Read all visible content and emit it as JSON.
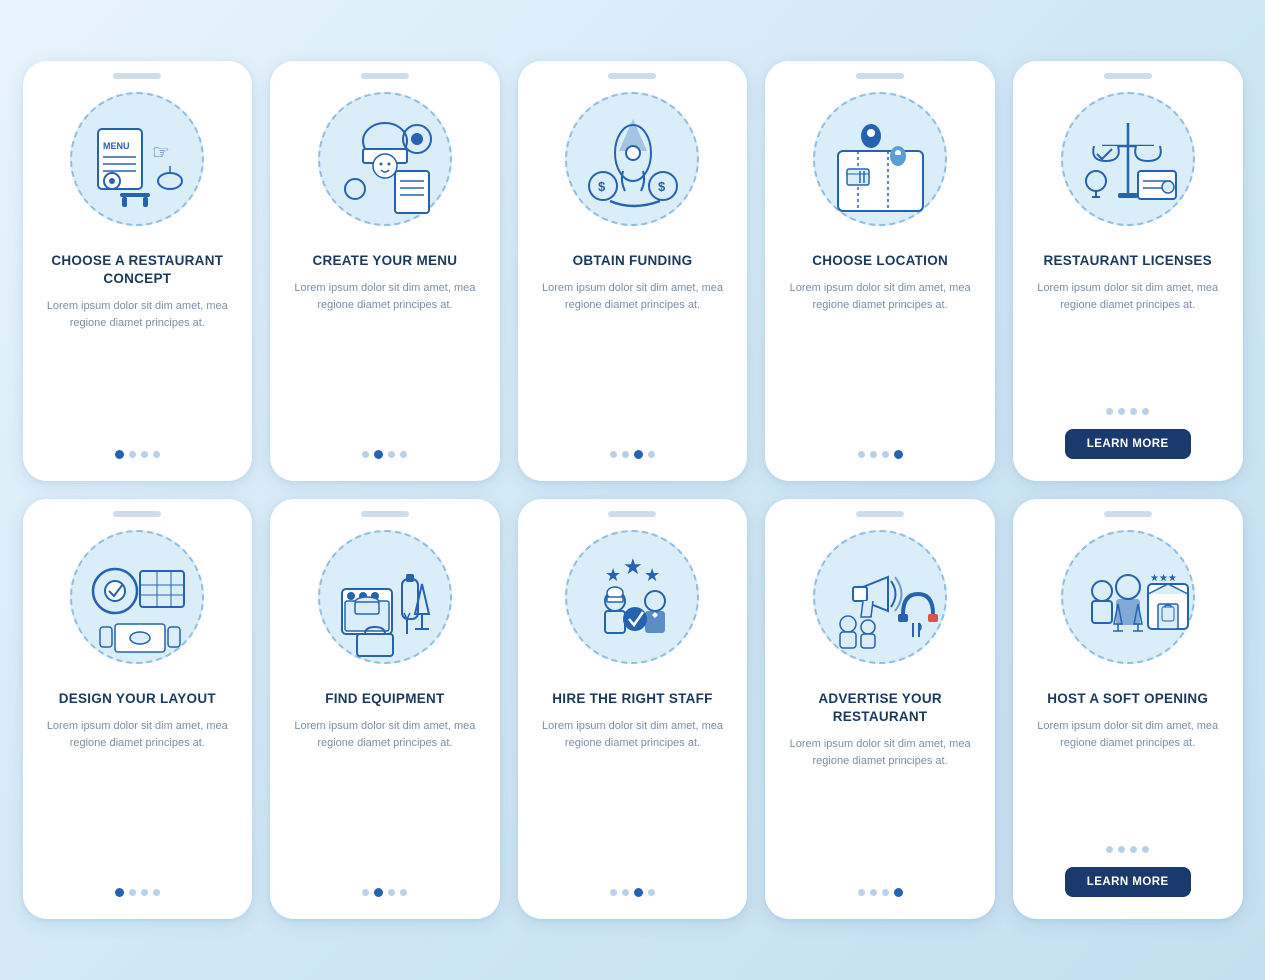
{
  "cards": [
    {
      "id": "choose-concept",
      "title": "CHOOSE A RESTAURANT CONCEPT",
      "body": "Lorem ipsum dolor sit dim amet, mea regione diamet principes at.",
      "dots": [
        1,
        0,
        0,
        0
      ],
      "hasButton": false,
      "buttonLabel": ""
    },
    {
      "id": "create-menu",
      "title": "CREATE YOUR MENU",
      "body": "Lorem ipsum dolor sit dim amet, mea regione diamet principes at.",
      "dots": [
        0,
        1,
        0,
        0
      ],
      "hasButton": false,
      "buttonLabel": ""
    },
    {
      "id": "obtain-funding",
      "title": "OBTAIN FUNDING",
      "body": "Lorem ipsum dolor sit dim amet, mea regione diamet principes at.",
      "dots": [
        0,
        0,
        1,
        0
      ],
      "hasButton": false,
      "buttonLabel": ""
    },
    {
      "id": "choose-location",
      "title": "CHOOSE LOCATION",
      "body": "Lorem ipsum dolor sit dim amet, mea regione diamet principes at.",
      "dots": [
        0,
        0,
        0,
        1
      ],
      "hasButton": false,
      "buttonLabel": ""
    },
    {
      "id": "restaurant-licenses",
      "title": "RESTAURANT LICENSES",
      "body": "Lorem ipsum dolor sit dim amet, mea regione diamet principes at.",
      "dots": [
        0,
        0,
        0,
        0
      ],
      "hasButton": true,
      "buttonLabel": "LEARN MORE"
    },
    {
      "id": "design-layout",
      "title": "DESIGN YOUR LAYOUT",
      "body": "Lorem ipsum dolor sit dim amet, mea regione diamet principes at.",
      "dots": [
        1,
        0,
        0,
        0
      ],
      "hasButton": false,
      "buttonLabel": ""
    },
    {
      "id": "find-equipment",
      "title": "FIND EQUIPMENT",
      "body": "Lorem ipsum dolor sit dim amet, mea regione diamet principes at.",
      "dots": [
        0,
        1,
        0,
        0
      ],
      "hasButton": false,
      "buttonLabel": ""
    },
    {
      "id": "hire-staff",
      "title": "HIRE THE RIGHT STAFF",
      "body": "Lorem ipsum dolor sit dim amet, mea regione diamet principes at.",
      "dots": [
        0,
        0,
        1,
        0
      ],
      "hasButton": false,
      "buttonLabel": ""
    },
    {
      "id": "advertise-restaurant",
      "title": "ADVERTISE YOUR RESTAURANT",
      "body": "Lorem ipsum dolor sit dim amet, mea regione diamet principes at.",
      "dots": [
        0,
        0,
        0,
        1
      ],
      "hasButton": false,
      "buttonLabel": ""
    },
    {
      "id": "host-opening",
      "title": "HOST A SOFT OPENING",
      "body": "Lorem ipsum dolor sit dim amet, mea regione diamet principes at.",
      "dots": [
        0,
        0,
        0,
        0
      ],
      "hasButton": true,
      "buttonLabel": "LEARN MORE"
    }
  ]
}
